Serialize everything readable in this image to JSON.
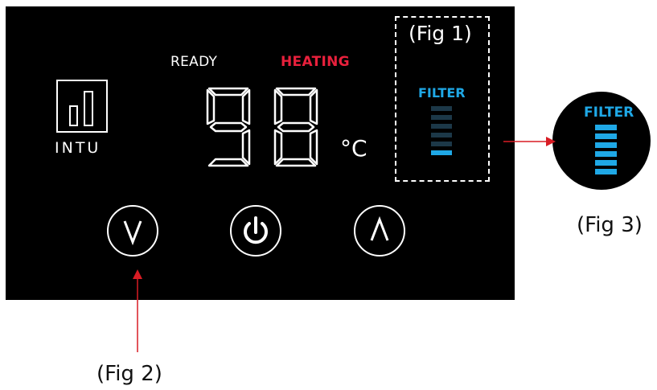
{
  "status": {
    "ready": "READY",
    "heating": "HEATING"
  },
  "logo": {
    "text": "INTU",
    "icon": "bar-chart-logo-icon"
  },
  "temperature": {
    "value": "98",
    "unit": "°C"
  },
  "filter": {
    "label": "FILTER",
    "small_levels_total": 6,
    "small_levels_lit": 1,
    "big_levels_total": 6,
    "big_levels_lit": 6
  },
  "buttons": {
    "down": "chevron-down-icon",
    "power": "power-icon",
    "up": "chevron-up-icon"
  },
  "figures": {
    "fig1": "(Fig 1)",
    "fig2": "(Fig 2)",
    "fig3": "(Fig 3)"
  },
  "colors": {
    "panel": "#000000",
    "heating": "#e8203c",
    "filter_blue": "#1fa8e6",
    "filter_dim": "#1c3848",
    "arrow": "#d81c24"
  }
}
